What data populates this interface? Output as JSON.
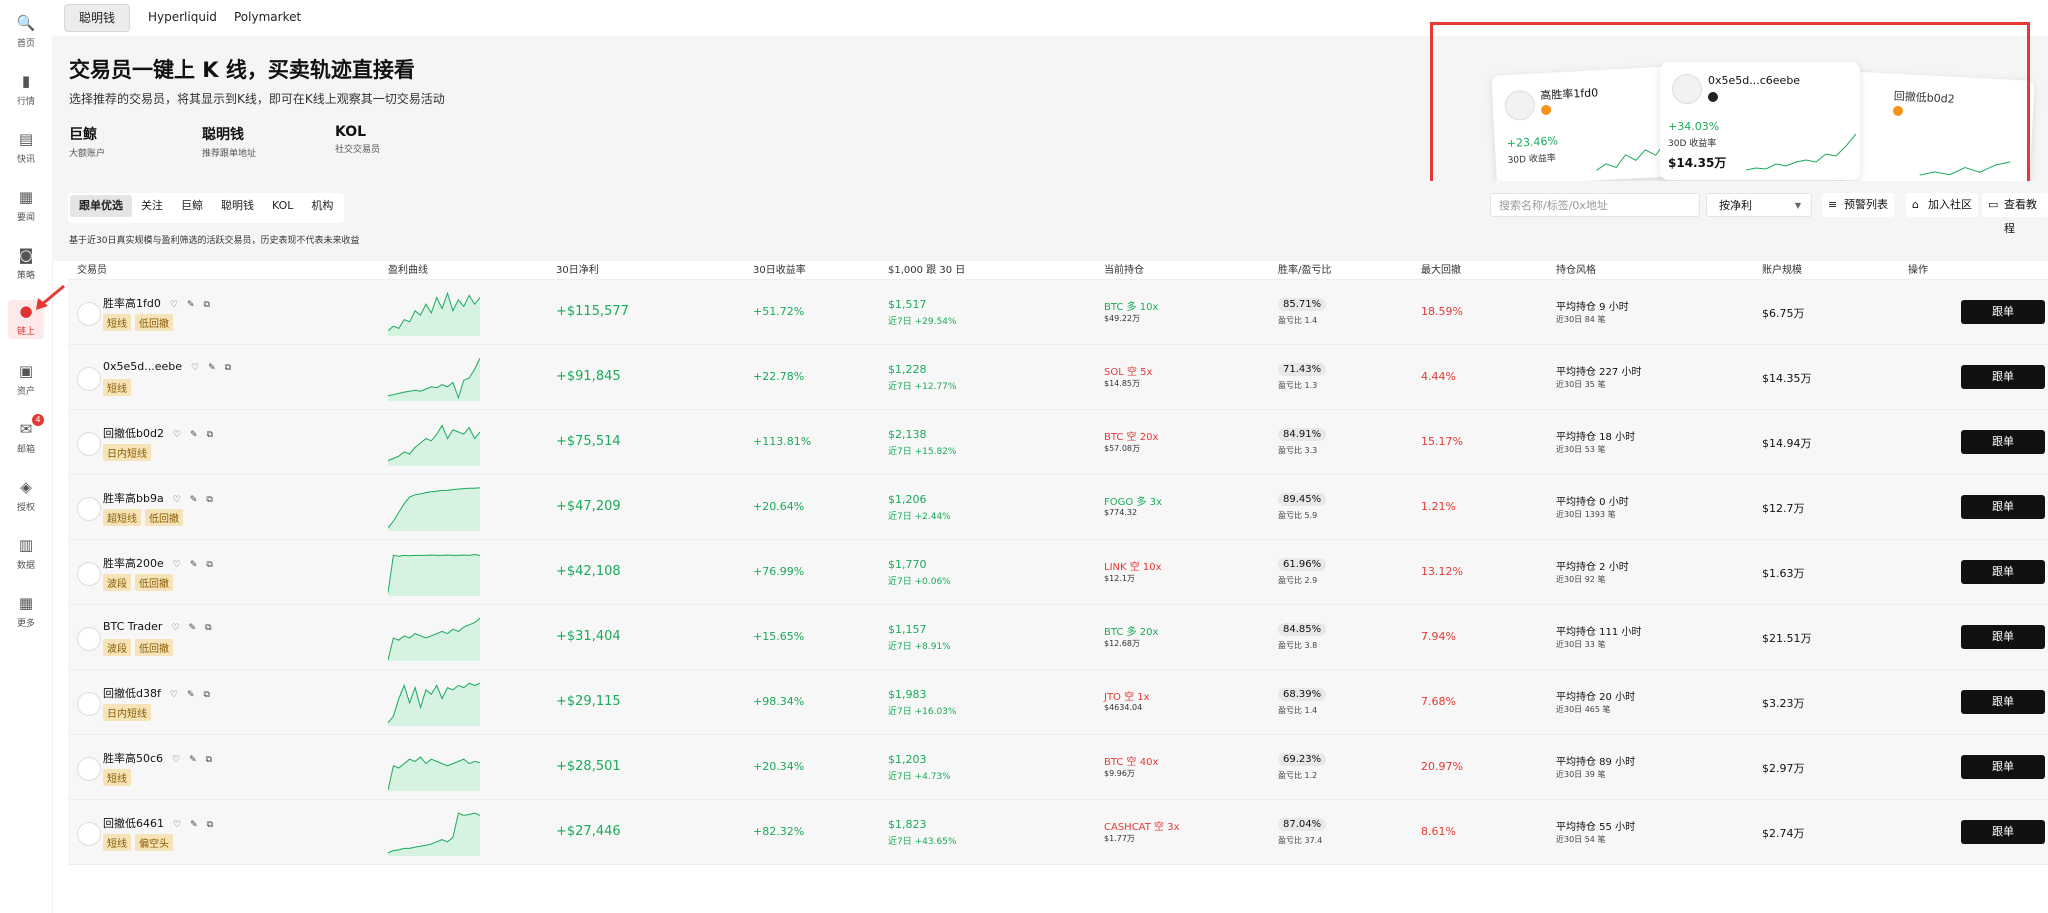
{
  "sidebar": {
    "items": [
      {
        "label": "首页",
        "icon": "search-icon"
      },
      {
        "label": "行情",
        "icon": "chart-bars-icon"
      },
      {
        "label": "快讯",
        "icon": "news-icon"
      },
      {
        "label": "要闻",
        "icon": "document-icon"
      },
      {
        "label": "策略",
        "icon": "robot-icon"
      },
      {
        "label": "链上",
        "icon": "panda-icon",
        "active": true
      },
      {
        "label": "资产",
        "icon": "wallet-icon"
      },
      {
        "label": "邮箱",
        "icon": "mail-icon",
        "badge": "4"
      },
      {
        "label": "授权",
        "icon": "share-icon"
      },
      {
        "label": "数据",
        "icon": "data-icon"
      },
      {
        "label": "更多",
        "icon": "grid-icon"
      }
    ]
  },
  "topbar": {
    "tabs": [
      {
        "label": "聪明钱",
        "active": true
      },
      {
        "label": "Hyperliquid"
      },
      {
        "label": "Polymarket"
      }
    ]
  },
  "hero": {
    "title": "交易员一键上 K 线，买卖轨迹直接看",
    "subtitle": "选择推荐的交易员，将其显示到K线，即可在K线上观察其一切交易活动",
    "categories": [
      {
        "title": "巨鲸",
        "desc": "大额账户"
      },
      {
        "title": "聪明钱",
        "desc": "推荐跟单地址"
      },
      {
        "title": "KOL",
        "desc": "社交交易员"
      }
    ],
    "preview_cards": [
      {
        "name": "高胜率1fd0",
        "return": "+23.46%",
        "return_label": "30D 收益率"
      },
      {
        "name": "0x5e5d...c6eebe",
        "return": "+34.03%",
        "return_label": "30D 收益率",
        "value": "$14.35万"
      },
      {
        "name": "回撤低b0d2"
      }
    ]
  },
  "filters": {
    "tabs": [
      {
        "label": "跟单优选",
        "active": true
      },
      {
        "label": "关注"
      },
      {
        "label": "巨鲸"
      },
      {
        "label": "聪明钱"
      },
      {
        "label": "KOL"
      },
      {
        "label": "机构"
      }
    ],
    "search_placeholder": "搜索名称/标签/0x地址",
    "sort_label": "按净利",
    "buttons": [
      {
        "label": "预警列表",
        "icon": "list-icon"
      },
      {
        "label": "加入社区",
        "icon": "home-icon"
      },
      {
        "label": "查看教程",
        "icon": "book-icon"
      }
    ],
    "note": "基于近30日真实规模与盈利筛选的活跃交易员，历史表现不代表未来收益"
  },
  "table": {
    "headers": {
      "trader": "交易员",
      "curve": "盈利曲线",
      "pnl": "30日净利",
      "ret": "30日收益率",
      "sim": "$1,000 跟 30 日",
      "pos": "当前持仓",
      "wr": "胜率/盈亏比",
      "dd": "最大回撤",
      "style": "持仓风格",
      "acct": "账户规模",
      "op": "操作"
    },
    "follow_label": "跟单",
    "rows": [
      {
        "name": "胜率高1fd0",
        "tags": [
          "短线",
          "低回撤"
        ],
        "pnl": "+$115,577",
        "ret": "+51.72%",
        "sim": "$1,517",
        "sim7": "近7日 +29.54%",
        "pos": "BTC 多 10x",
        "pos_dir": "long",
        "pos_val": "$49.22万",
        "wr": "85.71%",
        "pl": "盈亏比 1.4",
        "dd": "18.59%",
        "style": "平均持仓 9 小时",
        "trades": "近30日 84 笔",
        "acct": "$6.75万",
        "curve": [
          0.1,
          0.2,
          0.15,
          0.35,
          0.3,
          0.55,
          0.45,
          0.7,
          0.5,
          0.85,
          0.6,
          0.95,
          0.55,
          0.8,
          0.65,
          0.9,
          0.7,
          0.85
        ]
      },
      {
        "name": "0x5e5d...eebe",
        "tags": [
          "短线"
        ],
        "pnl": "+$91,845",
        "ret": "+22.78%",
        "sim": "$1,228",
        "sim7": "近7日 +12.77%",
        "pos": "SOL 空 5x",
        "pos_dir": "short",
        "pos_val": "$14.85万",
        "wr": "71.43%",
        "pl": "盈亏比 1.3",
        "dd": "4.44%",
        "style": "平均持仓 227 小时",
        "trades": "近30日 35 笔",
        "acct": "$14.35万",
        "curve": [
          0.1,
          0.12,
          0.15,
          0.18,
          0.2,
          0.22,
          0.2,
          0.25,
          0.3,
          0.28,
          0.35,
          0.3,
          0.4,
          0.05,
          0.45,
          0.5,
          0.7,
          0.95
        ]
      },
      {
        "name": "回撤低b0d2",
        "tags": [
          "日内短线"
        ],
        "pnl": "+$75,514",
        "ret": "+113.81%",
        "sim": "$2,138",
        "sim7": "近7日 +15.82%",
        "pos": "BTC 空 20x",
        "pos_dir": "short",
        "pos_val": "$57.08万",
        "wr": "84.91%",
        "pl": "盈亏比 3.3",
        "dd": "15.17%",
        "style": "平均持仓 18 小时",
        "trades": "近30日 53 笔",
        "acct": "$14.94万",
        "curve": [
          0.1,
          0.15,
          0.2,
          0.3,
          0.25,
          0.4,
          0.5,
          0.6,
          0.55,
          0.7,
          0.9,
          0.6,
          0.8,
          0.75,
          0.7,
          0.85,
          0.6,
          0.75
        ]
      },
      {
        "name": "胜率高bb9a",
        "tags": [
          "超短线",
          "低回撤"
        ],
        "pnl": "+$47,209",
        "ret": "+20.64%",
        "sim": "$1,206",
        "sim7": "近7日 +2.44%",
        "pos": "FOGO 多 3x",
        "pos_dir": "long",
        "pos_val": "$774.32",
        "wr": "89.45%",
        "pl": "盈亏比 5.9",
        "dd": "1.21%",
        "style": "平均持仓 0 小时",
        "trades": "近30日 1393 笔",
        "acct": "$12.7万",
        "curve": [
          0.05,
          0.2,
          0.4,
          0.6,
          0.75,
          0.8,
          0.82,
          0.85,
          0.87,
          0.88,
          0.9,
          0.9,
          0.92,
          0.93,
          0.94,
          0.95,
          0.95,
          0.96
        ]
      },
      {
        "name": "胜率高200e",
        "tags": [
          "波段",
          "低回撤"
        ],
        "pnl": "+$42,108",
        "ret": "+76.99%",
        "sim": "$1,770",
        "sim7": "近7日 +0.06%",
        "pos": "LINK 空 10x",
        "pos_dir": "short",
        "pos_val": "$12.1万",
        "wr": "61.96%",
        "pl": "盈亏比 2.9",
        "dd": "13.12%",
        "style": "平均持仓 2 小时",
        "trades": "近30日 92 笔",
        "acct": "$1.63万",
        "curve": [
          0.05,
          0.9,
          0.88,
          0.9,
          0.89,
          0.9,
          0.9,
          0.9,
          0.91,
          0.9,
          0.9,
          0.91,
          0.9,
          0.9,
          0.91,
          0.9,
          0.92,
          0.9
        ]
      },
      {
        "name": "BTC Trader",
        "tags": [
          "波段",
          "低回撤"
        ],
        "pnl": "+$31,404",
        "ret": "+15.65%",
        "sim": "$1,157",
        "sim7": "近7日 +8.91%",
        "pos": "BTC 多 20x",
        "pos_dir": "long",
        "pos_val": "$12.68万",
        "wr": "84.85%",
        "pl": "盈亏比 3.8",
        "dd": "7.94%",
        "style": "平均持仓 111 小时",
        "trades": "近30日 33 笔",
        "acct": "$21.51万",
        "curve": [
          0.0,
          0.5,
          0.45,
          0.55,
          0.5,
          0.6,
          0.55,
          0.5,
          0.55,
          0.6,
          0.65,
          0.6,
          0.7,
          0.65,
          0.75,
          0.8,
          0.85,
          0.95
        ]
      },
      {
        "name": "回撤低d38f",
        "tags": [
          "日内短线"
        ],
        "pnl": "+$29,115",
        "ret": "+98.34%",
        "sim": "$1,983",
        "sim7": "近7日 +16.03%",
        "pos": "JTO 空 1x",
        "pos_dir": "short",
        "pos_val": "$4634.04",
        "wr": "68.39%",
        "pl": "盈亏比 1.4",
        "dd": "7.68%",
        "style": "平均持仓 20 小时",
        "trades": "近30日 465 笔",
        "acct": "$3.23万",
        "curve": [
          0.05,
          0.2,
          0.6,
          0.9,
          0.5,
          0.85,
          0.4,
          0.8,
          0.7,
          0.9,
          0.6,
          0.85,
          0.8,
          0.9,
          0.85,
          0.95,
          0.9,
          0.95
        ]
      },
      {
        "name": "胜率高50c6",
        "tags": [
          "短线"
        ],
        "pnl": "+$28,501",
        "ret": "+20.34%",
        "sim": "$1,203",
        "sim7": "近7日 +4.73%",
        "pos": "BTC 空 40x",
        "pos_dir": "short",
        "pos_val": "$9.96万",
        "wr": "69.23%",
        "pl": "盈亏比 1.2",
        "dd": "20.97%",
        "style": "平均持仓 89 小时",
        "trades": "近30日 39 笔",
        "acct": "$2.97万",
        "curve": [
          0.0,
          0.55,
          0.5,
          0.6,
          0.7,
          0.65,
          0.75,
          0.6,
          0.7,
          0.65,
          0.6,
          0.55,
          0.6,
          0.65,
          0.7,
          0.6,
          0.65,
          0.62
        ]
      },
      {
        "name": "回撤低6461",
        "tags": [
          "短线",
          "偏空头"
        ],
        "pnl": "+$27,446",
        "ret": "+82.32%",
        "sim": "$1,823",
        "sim7": "近7日 +43.65%",
        "pos": "CASHCAT 空 3x",
        "pos_dir": "short",
        "pos_val": "$1.77万",
        "wr": "87.04%",
        "pl": "盈亏比 37.4",
        "dd": "8.61%",
        "style": "平均持仓 55 小时",
        "trades": "近30日 54 笔",
        "acct": "$2.74万",
        "curve": [
          0.05,
          0.1,
          0.12,
          0.15,
          0.15,
          0.18,
          0.2,
          0.22,
          0.25,
          0.3,
          0.35,
          0.3,
          0.4,
          0.95,
          0.9,
          0.92,
          0.95,
          0.9
        ]
      }
    ]
  },
  "colors": {
    "green": "#1aaa5a",
    "red": "#e53935",
    "highlight": "#e53935"
  }
}
